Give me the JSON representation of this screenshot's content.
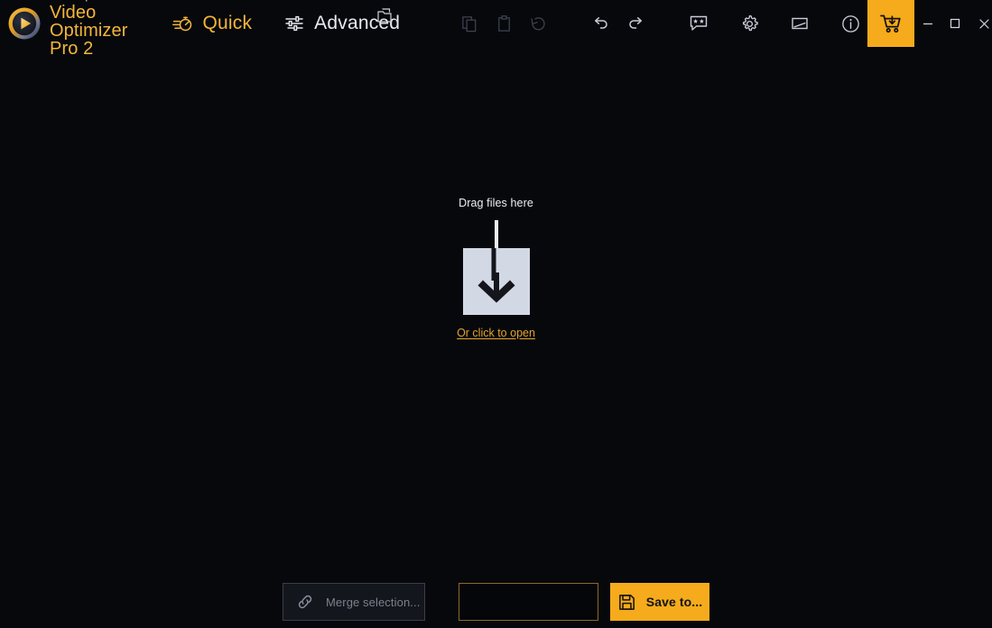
{
  "app": {
    "brand_superscript": "Ashampoo",
    "brand_registered": "®",
    "brand_title": "Video Optimizer Pro 2",
    "accent_color": "#f5ab1b",
    "accent_text_color": "#f3b53b",
    "background_color": "#07080c",
    "link_color": "#e2a42e"
  },
  "titlebar": {
    "modes": [
      {
        "label": "Quick",
        "icon": "stopwatch-icon",
        "active": true
      },
      {
        "label": "Advanced",
        "icon": "sliders-icon",
        "active": false
      }
    ],
    "overlay_icon": "open-folder-icon",
    "edit_tools": [
      {
        "name": "copy-icon",
        "tooltip": "Copy"
      },
      {
        "name": "paste-icon",
        "tooltip": "Paste"
      },
      {
        "name": "reset-icon",
        "tooltip": "Reset"
      }
    ],
    "history_tools": [
      {
        "name": "undo-icon",
        "tooltip": "Undo"
      },
      {
        "name": "redo-icon",
        "tooltip": "Redo"
      }
    ],
    "utility_tools": [
      {
        "name": "feedback-icon",
        "tooltip": "Rate this program"
      },
      {
        "name": "gear-icon",
        "tooltip": "Settings"
      },
      {
        "name": "theme-icon",
        "tooltip": "Change design"
      },
      {
        "name": "info-icon",
        "tooltip": "About"
      }
    ],
    "cart": {
      "name": "cart-download-icon",
      "tooltip": "Buy now"
    },
    "window_controls": [
      {
        "name": "minimize-button",
        "glyph": "–"
      },
      {
        "name": "maximize-button",
        "glyph": "□"
      },
      {
        "name": "close-button",
        "glyph": "✕"
      }
    ]
  },
  "dropzone": {
    "drag_text": "Drag files here",
    "open_link_text": "Or click to open",
    "icon": "download-arrow-into-box-icon"
  },
  "bottombar": {
    "merge_label": "Merge selection...",
    "merge_icon": "chain-link-icon",
    "merge_enabled": false,
    "path_value": "",
    "path_placeholder": "",
    "save_label": "Save to...",
    "save_icon": "floppy-disk-icon"
  }
}
